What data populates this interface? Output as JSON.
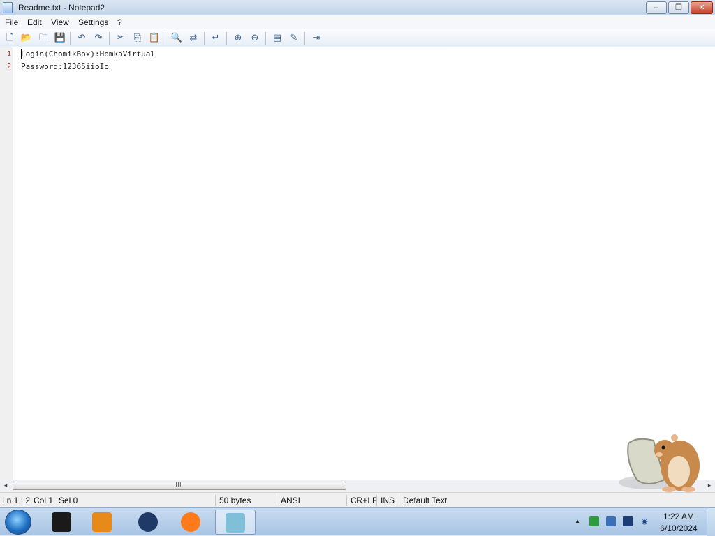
{
  "window": {
    "title": "Readme.txt - Notepad2",
    "buttons": {
      "minimize": "‒",
      "maximize": "❐",
      "close": "✕"
    }
  },
  "menu": {
    "items": [
      "File",
      "Edit",
      "View",
      "Settings",
      "?"
    ]
  },
  "toolbar": {
    "buttons": [
      {
        "name": "new-file-icon",
        "glyph": "🗋"
      },
      {
        "name": "open-folder-icon",
        "glyph": "📂"
      },
      {
        "name": "browse-icon",
        "glyph": "🗀"
      },
      {
        "name": "save-icon",
        "glyph": "💾"
      },
      {
        "name": "undo-icon",
        "glyph": "↶"
      },
      {
        "name": "redo-icon",
        "glyph": "↷"
      },
      {
        "name": "cut-icon",
        "glyph": "✂"
      },
      {
        "name": "copy-icon",
        "glyph": "⎘"
      },
      {
        "name": "paste-icon",
        "glyph": "📋"
      },
      {
        "name": "find-icon",
        "glyph": "🔍"
      },
      {
        "name": "replace-icon",
        "glyph": "⇄"
      },
      {
        "name": "word-wrap-icon",
        "glyph": "↵"
      },
      {
        "name": "zoom-in-icon",
        "glyph": "⊕"
      },
      {
        "name": "zoom-out-icon",
        "glyph": "⊖"
      },
      {
        "name": "scheme-icon",
        "glyph": "▤"
      },
      {
        "name": "scheme-config-icon",
        "glyph": "✎"
      },
      {
        "name": "exit-icon",
        "glyph": "⇥"
      }
    ]
  },
  "editor": {
    "lines": [
      {
        "number": "1",
        "text": "Login(ChomikBox):HomkaVirtual"
      },
      {
        "number": "2",
        "text": "Password:12365iioIo"
      }
    ]
  },
  "scrollbar": {
    "left_arrow": "◂",
    "right_arrow": "▸",
    "grip": "III"
  },
  "status": {
    "ln": "Ln 1 : 2",
    "col": "Col 1",
    "sel": "Sel 0",
    "size": "50 bytes",
    "encoding": "ANSI",
    "line_ending": "CR+LF",
    "mode": "INS",
    "scheme": "Default Text"
  },
  "taskbar": {
    "apps": [
      {
        "name": "terminal-app-icon",
        "color": "#1a1a1a"
      },
      {
        "name": "media-player-app-icon",
        "color": "#e88a1a"
      },
      {
        "name": "globe-app-icon",
        "color": "#1f3a66"
      },
      {
        "name": "firefox-app-icon",
        "color": "#ff7a1a"
      },
      {
        "name": "notepad2-app-icon",
        "color": "#7fc0d8"
      }
    ],
    "tray": {
      "show_hidden": "▴",
      "time": "1:22 AM",
      "date": "6/10/2024"
    }
  }
}
